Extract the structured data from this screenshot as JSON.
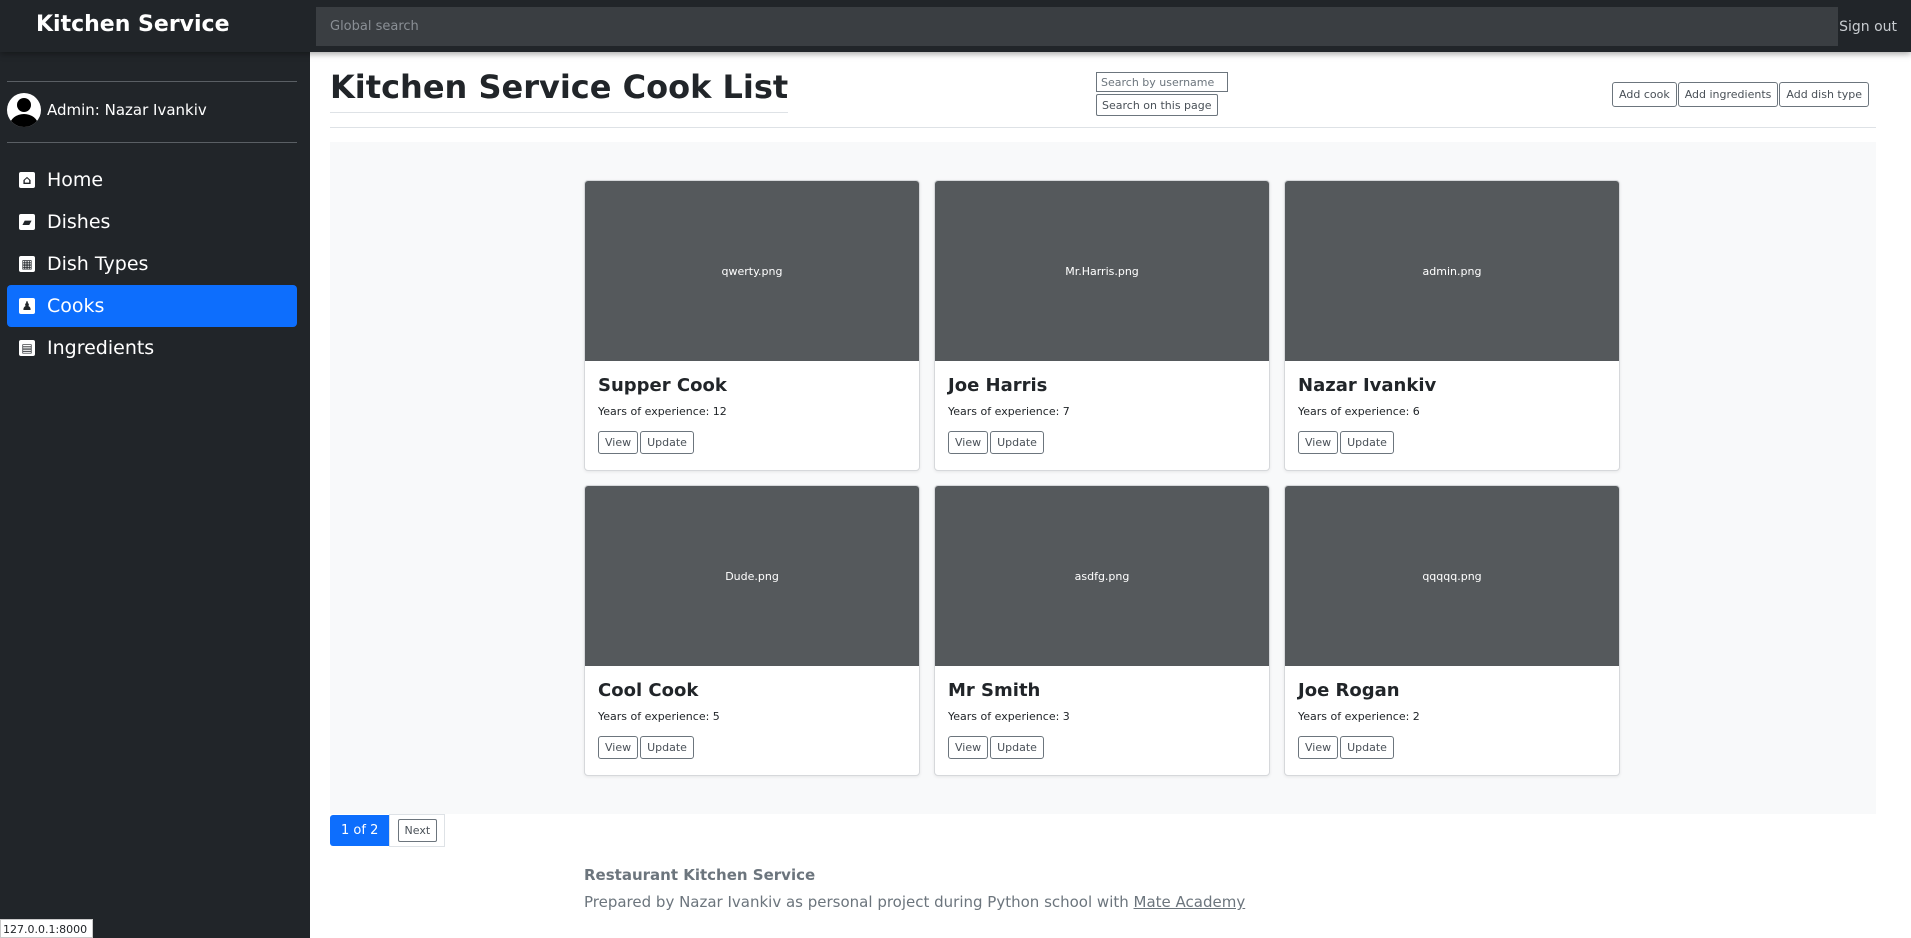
{
  "navbar": {
    "brand": "Kitchen Service",
    "search_placeholder": "Global search",
    "signout_label": "Sign out"
  },
  "sidebar": {
    "admin_label": "Admin: Nazar Ivankiv",
    "items": [
      {
        "label": "Home",
        "icon": "home-icon",
        "active": false
      },
      {
        "label": "Dishes",
        "icon": "dishes-icon",
        "active": false
      },
      {
        "label": "Dish Types",
        "icon": "dish-types-icon",
        "active": false
      },
      {
        "label": "Cooks",
        "icon": "cooks-icon",
        "active": true
      },
      {
        "label": "Ingredients",
        "icon": "ingredients-icon",
        "active": false
      }
    ]
  },
  "main": {
    "title": "Kitchen Service Cook List",
    "search_placeholder": "Search by username",
    "search_button": "Search on this page",
    "actions": {
      "add_cook": "Add cook",
      "add_ingredients": "Add ingredients",
      "add_dish_type": "Add dish type"
    },
    "cards": [
      {
        "image": "qwerty.png",
        "name": "Supper Cook",
        "experience": "Years of experience: 12"
      },
      {
        "image": "Mr.Harris.png",
        "name": "Joe Harris",
        "experience": "Years of experience: 7"
      },
      {
        "image": "admin.png",
        "name": "Nazar Ivankiv",
        "experience": "Years of experience: 6"
      },
      {
        "image": "Dude.png",
        "name": "Cool Cook",
        "experience": "Years of experience: 5"
      },
      {
        "image": "asdfg.png",
        "name": "Mr Smith",
        "experience": "Years of experience: 3"
      },
      {
        "image": "qqqqq.png",
        "name": "Joe Rogan",
        "experience": "Years of experience: 2"
      }
    ],
    "card_buttons": {
      "view": "View",
      "update": "Update"
    },
    "pagination": {
      "current": "1 of 2",
      "next": "Next"
    }
  },
  "footer": {
    "title": "Restaurant Kitchen Service",
    "text": "Prepared by Nazar Ivankiv as personal project during Python school with ",
    "link": "Mate Academy"
  },
  "status_bar": {
    "url": "127.0.0.1:8000"
  },
  "colors": {
    "accent": "#0d6efd",
    "dark": "#212529",
    "placeholder_image": "#55595c"
  }
}
